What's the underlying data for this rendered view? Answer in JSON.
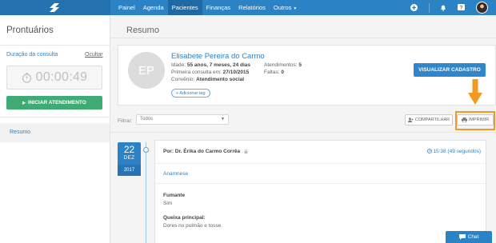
{
  "nav": {
    "items": [
      {
        "label": "Painel"
      },
      {
        "label": "Agenda"
      },
      {
        "label": "Pacientes",
        "active": true
      },
      {
        "label": "Finanças"
      },
      {
        "label": "Relatórios"
      },
      {
        "label": "Outros"
      }
    ],
    "accent_color": "#2b82c4"
  },
  "sidebar": {
    "title": "Prontuários",
    "duration_label": "Duração da consulta",
    "hide_label": "Ocultar",
    "timer": "00:00:49",
    "start_button": "INICIAR ATENDIMENTO",
    "nav_item": "Resumo"
  },
  "main": {
    "title": "Resumo"
  },
  "patient": {
    "initials": "EP",
    "name": "Elisabete Pereira do Carmo",
    "age_label": "Idade:",
    "age": "55 anos, 7 meses, 24 dias",
    "first_visit_label": "Primeira consulta em:",
    "first_visit": "27/10/2015",
    "insurance_label": "Convênio:",
    "insurance": "Atendimento social",
    "appointments_label": "Atendimentos:",
    "appointments": "5",
    "absences_label": "Faltas:",
    "absences": "0",
    "add_tag": "+ Adicionar tag",
    "view_button": "VISUALIZAR CADASTRO"
  },
  "toolbar": {
    "filter_label": "Filtrar:",
    "filter_value": "Todos",
    "share_button": "COMPARTILHAR",
    "print_button": "IMPRIMIR",
    "highlight_color": "#f29a1f"
  },
  "timeline": {
    "day": "22",
    "month": "DEZ",
    "year": "2017",
    "author": "Por: Dr. Érika do Carmo Corrêa",
    "time": "15:38 (49 segundos)",
    "section": "Anamnese",
    "fields": [
      {
        "label": "Fumante",
        "value": "Sim"
      },
      {
        "label": "Queixa principal:",
        "value": "Dores no pulmão e tosse."
      }
    ]
  },
  "chat": {
    "label": "Chat"
  }
}
